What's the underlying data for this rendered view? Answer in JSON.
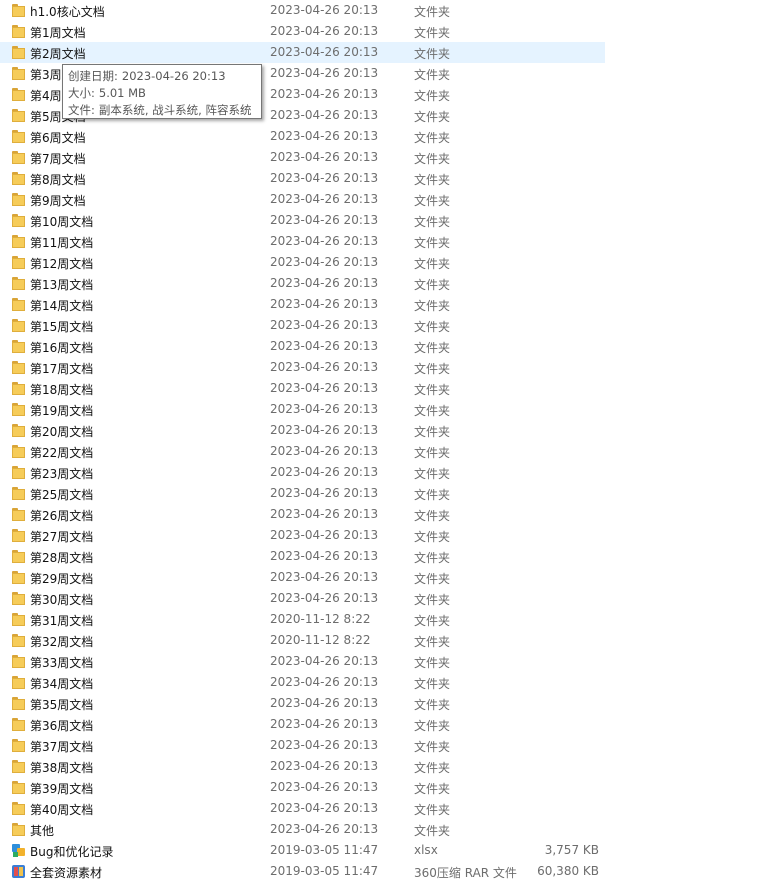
{
  "files": [
    {
      "name": "h1.0核心文档",
      "date": "2023-04-26 20:13",
      "type": "文件夹",
      "size": "",
      "icon": "folder-icon"
    },
    {
      "name": "第1周文档",
      "date": "2023-04-26 20:13",
      "type": "文件夹",
      "size": "",
      "icon": "folder-icon"
    },
    {
      "name": "第2周文档",
      "date": "2023-04-26 20:13",
      "type": "文件夹",
      "size": "",
      "icon": "folder-icon",
      "hovered": true
    },
    {
      "name": "第3周文档",
      "date": "2023-04-26 20:13",
      "type": "文件夹",
      "size": "",
      "icon": "folder-icon"
    },
    {
      "name": "第4周文档",
      "date": "2023-04-26 20:13",
      "type": "文件夹",
      "size": "",
      "icon": "folder-icon"
    },
    {
      "name": "第5周文档",
      "date": "2023-04-26 20:13",
      "type": "文件夹",
      "size": "",
      "icon": "folder-icon"
    },
    {
      "name": "第6周文档",
      "date": "2023-04-26 20:13",
      "type": "文件夹",
      "size": "",
      "icon": "folder-icon"
    },
    {
      "name": "第7周文档",
      "date": "2023-04-26 20:13",
      "type": "文件夹",
      "size": "",
      "icon": "folder-icon"
    },
    {
      "name": "第8周文档",
      "date": "2023-04-26 20:13",
      "type": "文件夹",
      "size": "",
      "icon": "folder-icon"
    },
    {
      "name": "第9周文档",
      "date": "2023-04-26 20:13",
      "type": "文件夹",
      "size": "",
      "icon": "folder-icon"
    },
    {
      "name": "第10周文档",
      "date": "2023-04-26 20:13",
      "type": "文件夹",
      "size": "",
      "icon": "folder-icon"
    },
    {
      "name": "第11周文档",
      "date": "2023-04-26 20:13",
      "type": "文件夹",
      "size": "",
      "icon": "folder-icon"
    },
    {
      "name": "第12周文档",
      "date": "2023-04-26 20:13",
      "type": "文件夹",
      "size": "",
      "icon": "folder-icon"
    },
    {
      "name": "第13周文档",
      "date": "2023-04-26 20:13",
      "type": "文件夹",
      "size": "",
      "icon": "folder-icon"
    },
    {
      "name": "第14周文档",
      "date": "2023-04-26 20:13",
      "type": "文件夹",
      "size": "",
      "icon": "folder-icon"
    },
    {
      "name": "第15周文档",
      "date": "2023-04-26 20:13",
      "type": "文件夹",
      "size": "",
      "icon": "folder-icon"
    },
    {
      "name": "第16周文档",
      "date": "2023-04-26 20:13",
      "type": "文件夹",
      "size": "",
      "icon": "folder-icon"
    },
    {
      "name": "第17周文档",
      "date": "2023-04-26 20:13",
      "type": "文件夹",
      "size": "",
      "icon": "folder-icon"
    },
    {
      "name": "第18周文档",
      "date": "2023-04-26 20:13",
      "type": "文件夹",
      "size": "",
      "icon": "folder-icon"
    },
    {
      "name": "第19周文档",
      "date": "2023-04-26 20:13",
      "type": "文件夹",
      "size": "",
      "icon": "folder-icon"
    },
    {
      "name": "第20周文档",
      "date": "2023-04-26 20:13",
      "type": "文件夹",
      "size": "",
      "icon": "folder-icon"
    },
    {
      "name": "第22周文档",
      "date": "2023-04-26 20:13",
      "type": "文件夹",
      "size": "",
      "icon": "folder-icon"
    },
    {
      "name": "第23周文档",
      "date": "2023-04-26 20:13",
      "type": "文件夹",
      "size": "",
      "icon": "folder-icon"
    },
    {
      "name": "第25周文档",
      "date": "2023-04-26 20:13",
      "type": "文件夹",
      "size": "",
      "icon": "folder-icon"
    },
    {
      "name": "第26周文档",
      "date": "2023-04-26 20:13",
      "type": "文件夹",
      "size": "",
      "icon": "folder-icon"
    },
    {
      "name": "第27周文档",
      "date": "2023-04-26 20:13",
      "type": "文件夹",
      "size": "",
      "icon": "folder-icon"
    },
    {
      "name": "第28周文档",
      "date": "2023-04-26 20:13",
      "type": "文件夹",
      "size": "",
      "icon": "folder-icon"
    },
    {
      "name": "第29周文档",
      "date": "2023-04-26 20:13",
      "type": "文件夹",
      "size": "",
      "icon": "folder-icon"
    },
    {
      "name": "第30周文档",
      "date": "2023-04-26 20:13",
      "type": "文件夹",
      "size": "",
      "icon": "folder-icon"
    },
    {
      "name": "第31周文档",
      "date": "2020-11-12 8:22",
      "type": "文件夹",
      "size": "",
      "icon": "folder-icon"
    },
    {
      "name": "第32周文档",
      "date": "2020-11-12 8:22",
      "type": "文件夹",
      "size": "",
      "icon": "folder-icon"
    },
    {
      "name": "第33周文档",
      "date": "2023-04-26 20:13",
      "type": "文件夹",
      "size": "",
      "icon": "folder-icon"
    },
    {
      "name": "第34周文档",
      "date": "2023-04-26 20:13",
      "type": "文件夹",
      "size": "",
      "icon": "folder-icon"
    },
    {
      "name": "第35周文档",
      "date": "2023-04-26 20:13",
      "type": "文件夹",
      "size": "",
      "icon": "folder-icon"
    },
    {
      "name": "第36周文档",
      "date": "2023-04-26 20:13",
      "type": "文件夹",
      "size": "",
      "icon": "folder-icon"
    },
    {
      "name": "第37周文档",
      "date": "2023-04-26 20:13",
      "type": "文件夹",
      "size": "",
      "icon": "folder-icon"
    },
    {
      "name": "第38周文档",
      "date": "2023-04-26 20:13",
      "type": "文件夹",
      "size": "",
      "icon": "folder-icon"
    },
    {
      "name": "第39周文档",
      "date": "2023-04-26 20:13",
      "type": "文件夹",
      "size": "",
      "icon": "folder-icon"
    },
    {
      "name": "第40周文档",
      "date": "2023-04-26 20:13",
      "type": "文件夹",
      "size": "",
      "icon": "folder-icon"
    },
    {
      "name": "其他",
      "date": "2023-04-26 20:13",
      "type": "文件夹",
      "size": "",
      "icon": "folder-icon"
    },
    {
      "name": "Bug和优化记录",
      "date": "2019-03-05 11:47",
      "type": "xlsx",
      "size": "3,757 KB",
      "icon": "xlsx-file-icon"
    },
    {
      "name": "全套资源素材",
      "date": "2019-03-05 11:47",
      "type": "360压缩 RAR 文件",
      "size": "60,380 KB",
      "icon": "rar-archive-icon"
    }
  ],
  "tooltip": {
    "created_label": "创建日期:",
    "created_value": "2023-04-26 20:13",
    "size_label": "大小:",
    "size_value": "5.01 MB",
    "files_label": "文件:",
    "files_value": "副本系统, 战斗系统, 阵容系统"
  },
  "colors": {
    "hover_row": "#e5f3ff",
    "folder": "#f6cc59",
    "secondary_text": "#6d6d6d"
  }
}
